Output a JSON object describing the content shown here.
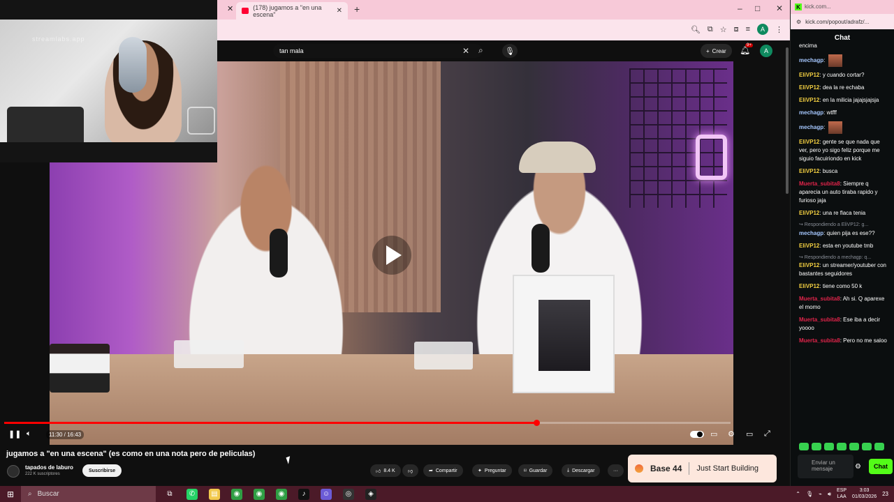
{
  "webcam": {
    "watermark": "streamlabs.app"
  },
  "browser": {
    "tab_title": "(178) jugamos a \"en una escena\"",
    "new_tab": "+",
    "window_controls": {
      "minimize": "–",
      "maximize": "□",
      "close": "✕"
    }
  },
  "youtube": {
    "search_value": "tan mala",
    "create_label": "Crear",
    "notif_count": "9+",
    "avatar_letter": "A",
    "time": "11:30 / 16:43",
    "progress": 0.733,
    "video_title": "jugamos a \"en una escena\" (es como en una nota pero de peliculas)",
    "channel_name": "tapados de laburo",
    "channel_subs": "222 K suscriptores",
    "subscribe": "Suscribirse",
    "actions": {
      "likes": "8.4 K",
      "share": "Compartir",
      "ask": "Preguntar",
      "save": "Guardar",
      "download": "Descargar",
      "more": "···"
    }
  },
  "ad": {
    "brand": "Base 44",
    "tagline": "Just Start Building"
  },
  "chat": {
    "tab_title": "kick.com...",
    "url": "kick.com/popout/adrafz/...",
    "header": "Chat",
    "messages": [
      {
        "user": "",
        "text": "encima",
        "color": "#ffffff",
        "reply": ""
      },
      {
        "user": "mechagp",
        "text": "",
        "color": "#a6c8ff",
        "reply": "",
        "emote": true
      },
      {
        "user": "EliVP12",
        "text": "y cuando cortar?",
        "color": "#f5d142",
        "reply": ""
      },
      {
        "user": "EliVP12",
        "text": "dea la re echaba",
        "color": "#f5d142",
        "reply": ""
      },
      {
        "user": "EliVP12",
        "text": "en la milicia jajajsjajsja",
        "color": "#f5d142",
        "reply": ""
      },
      {
        "user": "mechagp",
        "text": "wtfff",
        "color": "#a6c8ff",
        "reply": ""
      },
      {
        "user": "mechagp",
        "text": "",
        "color": "#a6c8ff",
        "reply": "",
        "emote": true
      },
      {
        "user": "EliVP12",
        "text": "gente se que nada que ver, pero yo sigo feliz porque me siguio facuiriondo en kick",
        "color": "#f5d142",
        "reply": ""
      },
      {
        "user": "EliVP12",
        "text": "busca",
        "color": "#f5d142",
        "reply": ""
      },
      {
        "user": "Muerta_subita8",
        "text": "Siempre q aparecia un auto tiraba rapido y furioso jaja",
        "color": "#e0244a",
        "reply": ""
      },
      {
        "user": "EliVP12",
        "text": "una re flaca tenia",
        "color": "#f5d142",
        "reply": ""
      },
      {
        "user": "mechagp",
        "text": "quien pija es ese??",
        "color": "#a6c8ff",
        "reply": "Respondiendo a EliVP12: g..."
      },
      {
        "user": "EliVP12",
        "text": "esta en youtube tmb",
        "color": "#f5d142",
        "reply": ""
      },
      {
        "user": "EliVP12",
        "text": "un streamer/youtuber con bastantes seguidores",
        "color": "#f5d142",
        "reply": "Respondiendo a mechagp: q..."
      },
      {
        "user": "EliVP12",
        "text": "tiene como 50 k",
        "color": "#f5d142",
        "reply": ""
      },
      {
        "user": "Muerta_subita8",
        "text": "Ah si. Q aparexe el momo",
        "color": "#e0244a",
        "reply": ""
      },
      {
        "user": "Muerta_subita8",
        "text": "Ese iba a decir yoooo",
        "color": "#e0244a",
        "reply": ""
      },
      {
        "user": "Muerta_subita8",
        "text": "Pero no me saloo",
        "color": "#e0244a",
        "reply": ""
      }
    ],
    "input_placeholder": "Enviar un mensaje",
    "send_label": "Chat"
  },
  "taskbar": {
    "search_label": "Buscar",
    "lang_top": "ESP",
    "lang_bottom": "LAA",
    "time": "3:03",
    "date": "01/03/2026",
    "notif_count": "23"
  }
}
